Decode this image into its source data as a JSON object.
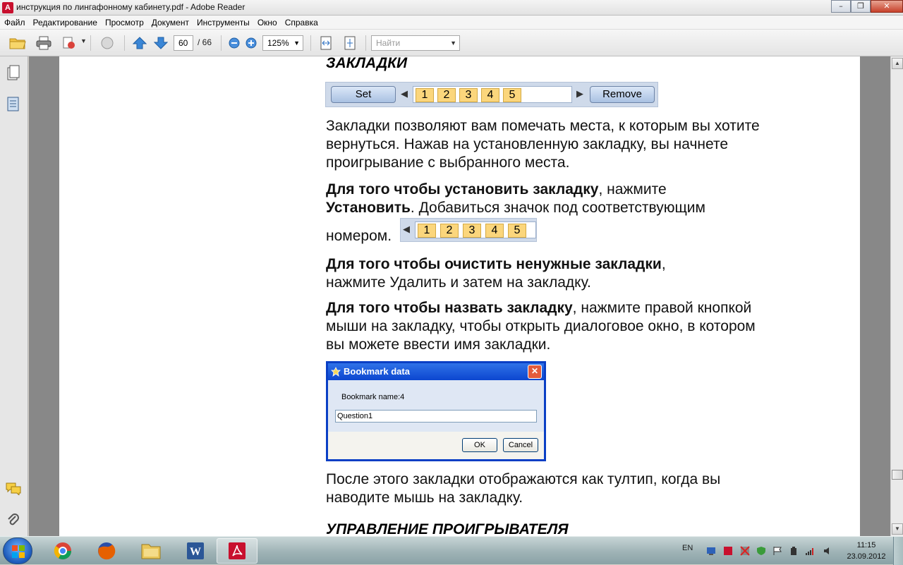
{
  "window": {
    "title": "инструкция по лингафонному кабинету.pdf - Adobe Reader",
    "minimize": "–",
    "restore": "❐",
    "close": "✕"
  },
  "menu": [
    "Файл",
    "Редактирование",
    "Просмотр",
    "Документ",
    "Инструменты",
    "Окно",
    "Справка"
  ],
  "toolbar": {
    "page_current": "60",
    "page_total": "/ 66",
    "zoom": "125%",
    "search_placeholder": "Найти"
  },
  "page": {
    "heading1": "ЗАКЛАДКИ",
    "strip1": {
      "set_label": "Set",
      "remove_label": "Remove",
      "numbers": [
        "1",
        "2",
        "3",
        "4",
        "5"
      ]
    },
    "p1": "Закладки позволяют вам помечать места, к которым вы хотите вернуться. Нажав на установленную закладку, вы начнете проигрывание с выбранного места.",
    "p2_bold": "Для того чтобы установить закладку",
    "p2_mid": ", нажмите",
    "p2_bold2": "Установить",
    "p2_rest": ". Добавиться значок под соответствующим",
    "p2_end": "номером.",
    "strip2_numbers": [
      "1",
      "2",
      "3",
      "4",
      "5"
    ],
    "p3_bold": "Для того чтобы очистить ненужные закладки",
    "p3_rest": ",",
    "p3_line2": "нажмите Удалить и затем на закладку.",
    "p4_bold": "Для того чтобы назвать закладку",
    "p4_rest": ", нажмите правой кнопкой мыши на закладку, чтобы открыть диалоговое окно, в котором вы можете ввести имя закладки.",
    "dialog": {
      "title": "Bookmark data",
      "label": "Bookmark name:4",
      "input_value": "Question1",
      "ok": "OK",
      "cancel": "Cancel"
    },
    "p5": "После этого закладки отображаются как тултип, когда вы наводите мышь на закладку.",
    "heading2": "УПРАВЛЕНИЕ ПРОИГРЫВАТЕЛЯ"
  },
  "taskbar": {
    "lang": "EN",
    "time": "11:15",
    "date": "23.09.2012"
  },
  "colors": {
    "accent_blue": "#0c46d0",
    "bookmark_yellow": "#fbd67c",
    "adobe_red": "#c8102e"
  }
}
